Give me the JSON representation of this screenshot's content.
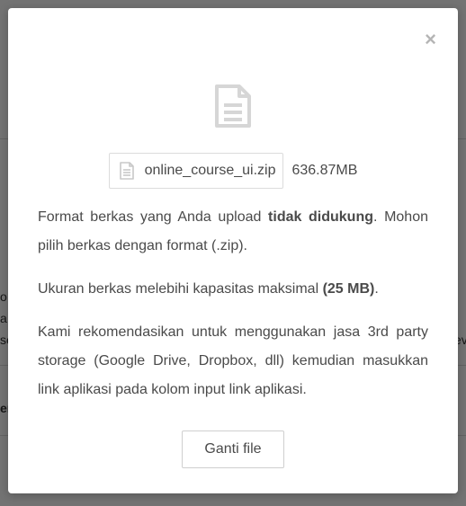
{
  "modal": {
    "close_label": "×",
    "file": {
      "name": "online_course_ui.zip",
      "size": "636.87MB"
    },
    "messages": {
      "p1_a": "Format berkas yang Anda upload ",
      "p1_b": "tidak didukung",
      "p1_c": ". Mohon pilih berkas dengan format (.zip).",
      "p2_a": "Ukuran berkas melebihi kapasitas maksimal ",
      "p2_b": "(25 MB)",
      "p2_c": ".",
      "p3": "Kami rekomendasikan untuk menggunakan jasa 3rd party storage (Google Drive, Dropbox, dll) kemudian masukkan link aplikasi pada kolom input link aplikasi."
    },
    "button_label": "Ganti file",
    "icon_color": "#d6d6d6"
  },
  "background": {
    "fragments": [
      "o",
      "a",
      "se",
      "ev",
      "er"
    ]
  }
}
